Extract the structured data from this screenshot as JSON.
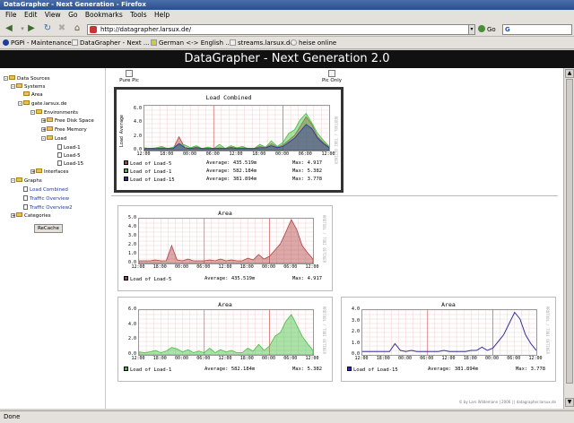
{
  "window": {
    "title": "DataGrapher - Next Generation - Firefox"
  },
  "menu": [
    "File",
    "Edit",
    "View",
    "Go",
    "Bookmarks",
    "Tools",
    "Help"
  ],
  "nav": {
    "url": "http://datagrapher.larsux.de/",
    "go_label": "Go"
  },
  "bookmarks": [
    "PGPi - Maintenance",
    "DataGrapher - Next ...",
    "German <-> English ...",
    "streams.larsux.de",
    "heise online"
  ],
  "page": {
    "header": "DataGrapher - Next Generation 2.0"
  },
  "sidebar": {
    "items": [
      {
        "label": "Data Sources"
      },
      {
        "label": "Systems"
      },
      {
        "label": "Area"
      },
      {
        "label": "gate.larsux.de"
      },
      {
        "label": "Environments"
      },
      {
        "label": "Free Disk Space"
      },
      {
        "label": "Free Memory"
      },
      {
        "label": "Load"
      },
      {
        "label": "Load-1"
      },
      {
        "label": "Load-5"
      },
      {
        "label": "Load-15"
      },
      {
        "label": "Interfaces"
      },
      {
        "label": "Graphs"
      },
      {
        "label": "Load Combined"
      },
      {
        "label": "Traffic Overview"
      },
      {
        "label": "Traffic Overview2"
      },
      {
        "label": "Categories"
      }
    ],
    "recache_label": "ReCache"
  },
  "toolbar": {
    "pure_pic": "Pure Pic",
    "pic_only": "Pic Only"
  },
  "footer": "© by Lars Wildemann | 2006 | | datagrapher.larsux.de",
  "status": "Done",
  "colors": {
    "load5": "#b04040",
    "load1": "#40c040",
    "load15": "#3030a0",
    "header_bg": "#111111"
  },
  "chart_data": [
    {
      "type": "area",
      "title": "Load Combined",
      "ylabel": "Load Average",
      "x": [
        "12:00",
        "18:00",
        "00:00",
        "06:00",
        "12:00",
        "18:00",
        "00:00",
        "06:00",
        "12:00"
      ],
      "yticks": [
        "0.0",
        "2.0",
        "4.0",
        "6.0"
      ],
      "ylim": [
        0,
        6.5
      ],
      "series": [
        {
          "name": "Load of Load-5",
          "color": "#b04040",
          "average": "435.519m",
          "max": "4.917",
          "values": [
            0.3,
            0.3,
            0.3,
            0.4,
            0.3,
            0.3,
            2.0,
            0.4,
            0.3,
            0.5,
            0.3,
            0.3,
            0.3,
            0.4,
            0.3,
            0.5,
            0.3,
            0.4,
            0.3,
            0.3,
            0.6,
            0.4,
            1.0,
            0.5,
            0.8,
            1.5,
            2.2,
            3.5,
            4.9,
            3.8,
            2.0,
            1.2,
            0.5
          ]
        },
        {
          "name": "Load of Load-1",
          "color": "#40c040",
          "average": "582.184m",
          "max": "5.382",
          "values": [
            0.4,
            0.3,
            0.4,
            0.6,
            0.3,
            0.5,
            1.0,
            0.8,
            0.4,
            0.7,
            0.3,
            0.5,
            0.3,
            0.9,
            0.3,
            0.7,
            0.4,
            0.6,
            0.3,
            0.3,
            0.9,
            0.5,
            1.4,
            0.6,
            1.2,
            2.5,
            3.0,
            4.5,
            5.4,
            4.0,
            2.5,
            1.5,
            0.6
          ]
        },
        {
          "name": "Load of Load-15",
          "color": "#3030a0",
          "average": "381.894m",
          "max": "3.778",
          "values": [
            0.3,
            0.3,
            0.3,
            0.3,
            0.3,
            0.3,
            1.0,
            0.4,
            0.3,
            0.4,
            0.3,
            0.3,
            0.3,
            0.3,
            0.3,
            0.4,
            0.3,
            0.3,
            0.3,
            0.3,
            0.4,
            0.4,
            0.7,
            0.4,
            0.6,
            1.2,
            1.8,
            2.8,
            3.8,
            3.2,
            1.8,
            1.0,
            0.4
          ]
        }
      ]
    },
    {
      "type": "area",
      "title": "Area",
      "x": [
        "12:00",
        "18:00",
        "00:00",
        "06:00",
        "12:00",
        "18:00",
        "00:00",
        "06:00",
        "12:00"
      ],
      "yticks": [
        "0.0",
        "1.0",
        "2.0",
        "3.0",
        "4.0",
        "5.0"
      ],
      "ylim": [
        0,
        5
      ],
      "series": [
        {
          "name": "Load of Load-5",
          "color": "#b04040",
          "average": "435.519m",
          "max": "4.917",
          "values": [
            0.3,
            0.3,
            0.3,
            0.4,
            0.3,
            0.3,
            2.0,
            0.4,
            0.3,
            0.5,
            0.3,
            0.3,
            0.3,
            0.4,
            0.3,
            0.5,
            0.3,
            0.4,
            0.3,
            0.3,
            0.6,
            0.4,
            1.0,
            0.5,
            0.8,
            1.5,
            2.2,
            3.5,
            4.9,
            3.8,
            2.0,
            1.2,
            0.5
          ]
        }
      ]
    },
    {
      "type": "area",
      "title": "Area",
      "x": [
        "12:00",
        "18:00",
        "00:00",
        "06:00",
        "12:00",
        "18:00",
        "00:00",
        "06:00",
        "12:00"
      ],
      "yticks": [
        "0.0",
        "2.0",
        "4.0",
        "6.0"
      ],
      "ylim": [
        0,
        6
      ],
      "series": [
        {
          "name": "Load of Load-1",
          "color": "#40c040",
          "average": "582.184m",
          "max": "5.382",
          "values": [
            0.4,
            0.3,
            0.4,
            0.6,
            0.3,
            0.5,
            1.0,
            0.8,
            0.4,
            0.7,
            0.3,
            0.5,
            0.3,
            0.9,
            0.3,
            0.7,
            0.4,
            0.6,
            0.3,
            0.3,
            0.9,
            0.5,
            1.4,
            0.6,
            1.2,
            2.5,
            3.0,
            4.5,
            5.4,
            4.0,
            2.5,
            1.5,
            0.6
          ]
        }
      ]
    },
    {
      "type": "line",
      "title": "Area",
      "x": [
        "12:00",
        "18:00",
        "00:00",
        "06:00",
        "12:00",
        "18:00",
        "00:00",
        "06:00",
        "12:00"
      ],
      "yticks": [
        "0.0",
        "1.0",
        "2.0",
        "3.0",
        "4.0"
      ],
      "ylim": [
        0,
        4
      ],
      "series": [
        {
          "name": "Load of Load-15",
          "color": "#3030a0",
          "average": "381.894m",
          "max": "3.778",
          "values": [
            0.3,
            0.3,
            0.3,
            0.3,
            0.3,
            0.3,
            1.0,
            0.4,
            0.3,
            0.4,
            0.3,
            0.3,
            0.3,
            0.3,
            0.3,
            0.4,
            0.3,
            0.3,
            0.3,
            0.3,
            0.4,
            0.4,
            0.7,
            0.4,
            0.6,
            1.2,
            1.8,
            2.8,
            3.8,
            3.2,
            1.8,
            1.0,
            0.4
          ]
        }
      ]
    }
  ]
}
